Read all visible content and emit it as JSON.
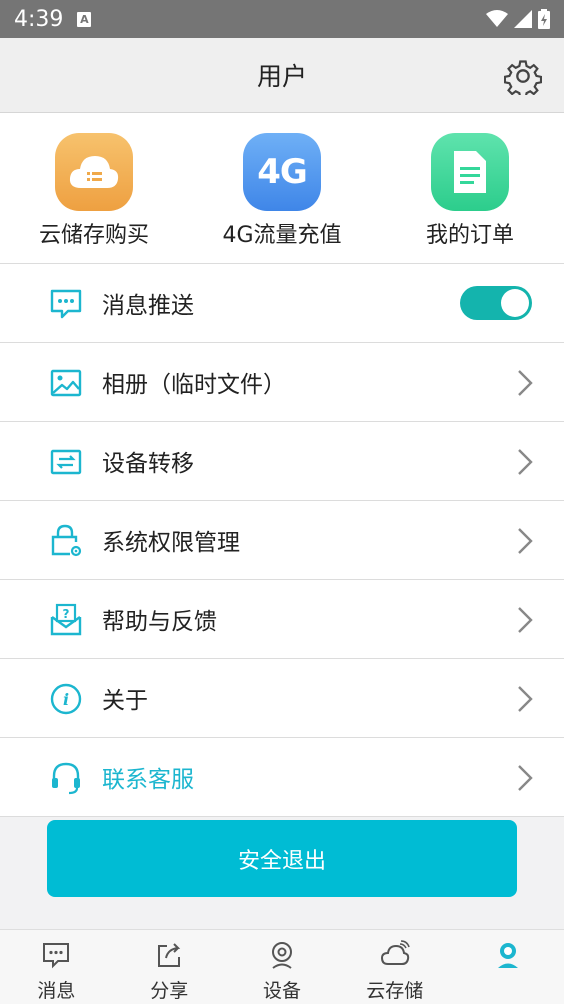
{
  "status_bar": {
    "time": "4:39",
    "notification_letter": "A"
  },
  "header": {
    "title": "用户"
  },
  "quick_actions": [
    {
      "label": "云储存购买",
      "icon": "cloud-storage-icon",
      "color": "#f0a94a"
    },
    {
      "label": "4G流量充值",
      "icon": "4g-icon",
      "icon_text": "4G",
      "color": "#4f95ef"
    },
    {
      "label": "我的订单",
      "icon": "order-document-icon",
      "color": "#34d79a"
    }
  ],
  "menu": [
    {
      "label": "消息推送",
      "icon": "message-chat-icon",
      "control": "toggle",
      "enabled": true
    },
    {
      "label": "相册（临时文件）",
      "icon": "photo-album-icon",
      "control": "chevron"
    },
    {
      "label": "设备转移",
      "icon": "device-transfer-icon",
      "control": "chevron"
    },
    {
      "label": "系统权限管理",
      "icon": "permission-lock-icon",
      "control": "chevron"
    },
    {
      "label": "帮助与反馈",
      "icon": "help-feedback-icon",
      "control": "chevron"
    },
    {
      "label": "关于",
      "icon": "info-icon",
      "control": "chevron"
    },
    {
      "label": "联系客服",
      "icon": "headset-icon",
      "control": "chevron",
      "accent": true
    }
  ],
  "logout_button": {
    "label": "安全退出"
  },
  "tabs": [
    {
      "label": "消息",
      "icon": "message-icon"
    },
    {
      "label": "分享",
      "icon": "share-icon"
    },
    {
      "label": "设备",
      "icon": "device-camera-icon"
    },
    {
      "label": "云存储",
      "icon": "cloud-icon"
    },
    {
      "label": "",
      "icon": "user-icon",
      "active": true
    }
  ],
  "colors": {
    "accent": "#1cb6cf",
    "toggle_on": "#14b4ad",
    "logout_button": "#00bcd4"
  }
}
